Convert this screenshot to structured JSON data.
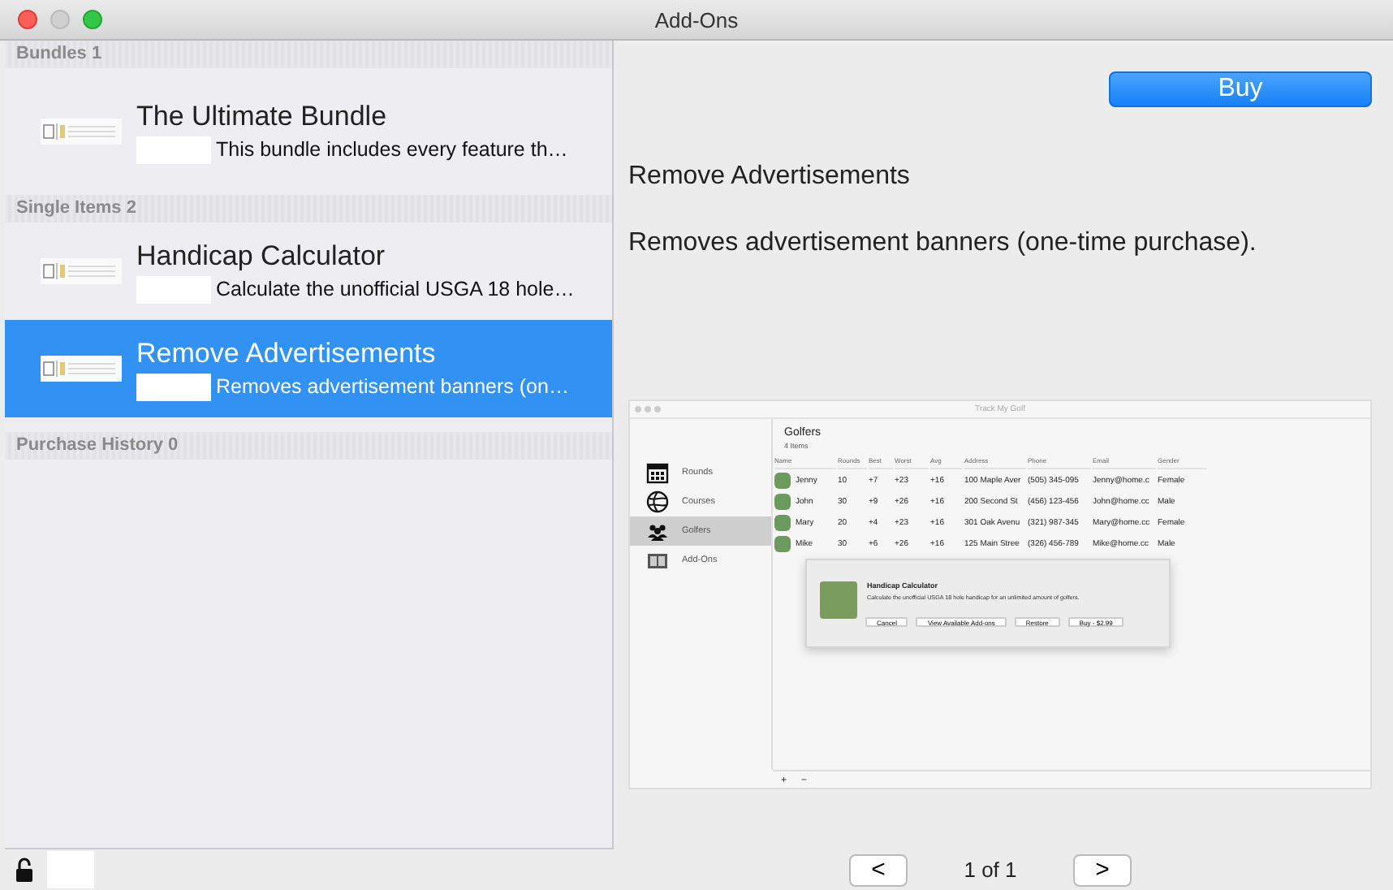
{
  "window": {
    "title": "Add-Ons"
  },
  "sections": [
    {
      "title": "Bundles 1",
      "items": [
        {
          "title": "The Ultimate Bundle",
          "description": "This bundle includes every feature th…",
          "selected": false
        }
      ]
    },
    {
      "title": "Single Items 2",
      "items": [
        {
          "title": "Handicap Calculator",
          "description": "Calculate the unofficial USGA 18 hole…",
          "selected": false
        },
        {
          "title": "Remove Advertisements",
          "description": "Removes advertisement banners (on…",
          "selected": true
        }
      ]
    },
    {
      "title": "Purchase History 0"
    }
  ],
  "detail": {
    "buy_button": "Buy",
    "title": "Remove Advertisements",
    "description": "Removes advertisement banners (one-time purchase).",
    "preview": {
      "window_title": "Track My Golf",
      "sidebar": [
        {
          "label": "Rounds",
          "selected": false
        },
        {
          "label": "Courses",
          "selected": false
        },
        {
          "label": "Golfers",
          "selected": true
        },
        {
          "label": "Add-Ons",
          "selected": false
        }
      ],
      "header": "Golfers",
      "count": "4 Items",
      "columns": [
        "Name",
        "Rounds",
        "Best",
        "Worst",
        "Avg",
        "Address",
        "Phone",
        "Email",
        "Gender"
      ],
      "rows": [
        {
          "cells": [
            "Jenny",
            "10",
            "+7",
            "+23",
            "+16",
            "100 Maple Aver",
            "(505) 345-095",
            "Jenny@home.c",
            "Female"
          ]
        },
        {
          "cells": [
            "John",
            "30",
            "+9",
            "+26",
            "+16",
            "200 Second St",
            "(456) 123-456",
            "John@home.cc",
            "Male"
          ]
        },
        {
          "cells": [
            "Mary",
            "20",
            "+4",
            "+23",
            "+16",
            "301 Oak Avenu",
            "(321) 987-345",
            "Mary@home.cc",
            "Female"
          ]
        },
        {
          "cells": [
            "Mike",
            "30",
            "+6",
            "+26",
            "+16",
            "125 Main Stree",
            "(326) 456-789",
            "Mike@home.cc",
            "Male"
          ]
        }
      ],
      "dialog": {
        "title": "Handicap Calculator",
        "message": "Calculate the unofficial USGA 18 hole handicap for an unlimited amount of golfers.",
        "buttons": [
          "Cancel",
          "View Available Add-ons",
          "Restore",
          "Buy - $2.99"
        ]
      },
      "toolbar": [
        "+",
        "−"
      ]
    }
  },
  "pager": {
    "previous": "<",
    "page": "1 of 1",
    "next": ">"
  }
}
